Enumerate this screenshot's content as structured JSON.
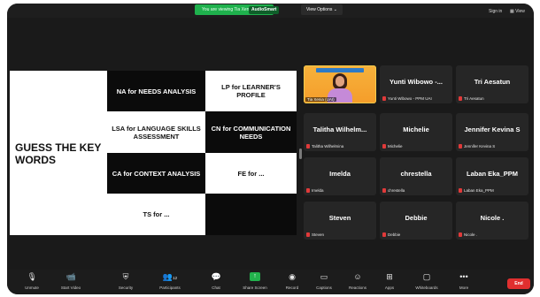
{
  "top_bar": {
    "banner_text": "You are viewing Tia Xenia's screen",
    "banner_pill": "AudioSmart",
    "view_options": "View Options ⌄",
    "sign_in": "Sign in",
    "view": "View"
  },
  "slide": {
    "title": "GUESS THE KEY WORDS",
    "cells": {
      "na": "NA for NEEDS ANALYSIS",
      "lp": "LP for LEARNER'S PROFILE",
      "lsa": "LSA for LANGUAGE SKILLS ASSESSMENT",
      "cn": "CN for COMMUNICATION NEEDS",
      "ca": "CA for CONTEXT ANALYSIS",
      "fe": "FE for ...",
      "ts": "TS for ...",
      "blank": ""
    }
  },
  "gallery": {
    "speaker_label": "Tia Xenia (UAI)",
    "participants": [
      {
        "name": "Yunti Wibowo -...",
        "label": "Yunti Wibowo - PPM UAI"
      },
      {
        "name": "Tri Aesatun",
        "label": "Tri Aesatun"
      },
      {
        "name": "Talitha Wilhelm...",
        "label": "Talitha Wilhelmina"
      },
      {
        "name": "Michelie",
        "label": "Michelie"
      },
      {
        "name": "Jennifer Kevina S",
        "label": "Jennifer Kevina S"
      },
      {
        "name": "Imelda",
        "label": "Imelda"
      },
      {
        "name": "chrestella",
        "label": "chrestella"
      },
      {
        "name": "Laban Eka_PPM",
        "label": "Laban Eka_PPM"
      },
      {
        "name": "Steven",
        "label": "Steven"
      },
      {
        "name": "Debbie",
        "label": "Debbie"
      },
      {
        "name": "Nicole .",
        "label": "Nicole ."
      }
    ]
  },
  "toolbar": {
    "unmute": "Unmute",
    "start_video": "Start Video",
    "security": "Security",
    "participants": "Participants",
    "participants_count": "12",
    "chat": "Chat",
    "share_screen": "Share Screen",
    "record": "Record",
    "captions": "Captions",
    "reactions": "Reactions",
    "apps": "Apps",
    "whiteboards": "Whiteboards",
    "more": "More",
    "end": "End"
  },
  "colors": {
    "share_green": "#22b14c",
    "end_red": "#e02f2f",
    "speaker_yellow": "#f2c94c"
  }
}
